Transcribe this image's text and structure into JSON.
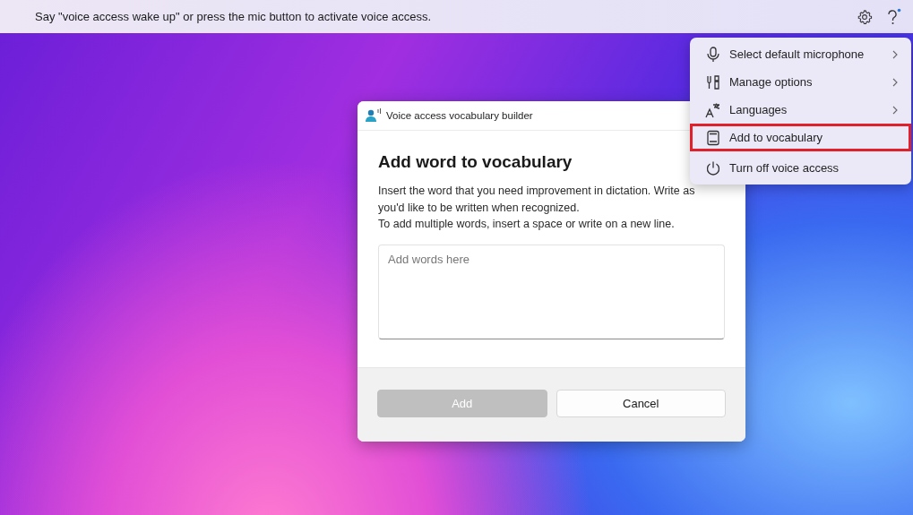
{
  "top_bar": {
    "message": "Say \"voice access wake up\" or press the mic button to activate voice access."
  },
  "menu": {
    "items": [
      {
        "kind": "microphone",
        "label": "Select default microphone",
        "submenu": true,
        "highlighted": false
      },
      {
        "kind": "options",
        "label": "Manage options",
        "submenu": true,
        "highlighted": false
      },
      {
        "kind": "languages",
        "label": "Languages",
        "submenu": true,
        "highlighted": false
      },
      {
        "kind": "vocabulary",
        "label": "Add to vocabulary",
        "submenu": false,
        "highlighted": true
      },
      {
        "kind": "power",
        "label": "Turn off voice access",
        "submenu": false,
        "highlighted": false
      }
    ]
  },
  "dialog": {
    "title": "Voice access vocabulary builder",
    "heading": "Add word to vocabulary",
    "description": [
      "Insert the word that you need improvement in dictation. Write as you'd like to be written when recognized.",
      "To add multiple words, insert a space or write on a new line."
    ],
    "input": {
      "placeholder": "Add words here"
    },
    "buttons": [
      {
        "label": "Add",
        "disabled": true
      },
      {
        "label": "Cancel",
        "disabled": false
      }
    ]
  }
}
